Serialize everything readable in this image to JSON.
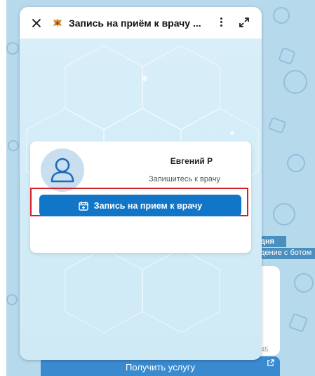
{
  "window": {
    "title": "Запись на приём к врачу ...",
    "icons": {
      "close": "close-icon",
      "emblem": "coat-of-arms-icon",
      "menu": "more-vertical-icon",
      "expand": "expand-icon"
    }
  },
  "profile": {
    "name": "Евгений Р",
    "hint": "Запишитесь к врачу",
    "avatar_icon": "user-icon"
  },
  "actions": {
    "book_label": "Запись на прием к врачу",
    "book_icon": "calendar-add-icon"
  },
  "chat": {
    "date_label": "дня",
    "service_label": "дение с ботом",
    "time_label": ":45",
    "bottom_button": "Получить услугу",
    "external_icon": "open-external-icon"
  },
  "colors": {
    "accent": "#1175c8",
    "highlight": "#d42027",
    "chat_bg": "#b7d9ec",
    "bottom_button": "#3a8ad0"
  }
}
